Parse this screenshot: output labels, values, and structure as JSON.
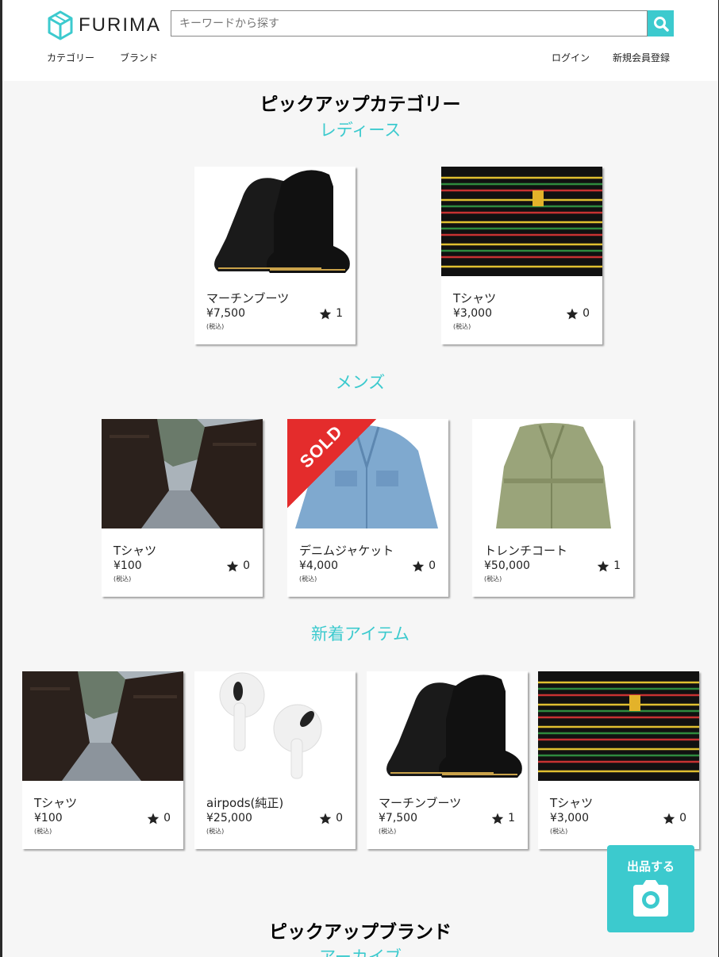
{
  "header": {
    "logo_text": "FURIMA",
    "search_placeholder": "キーワードから探す",
    "nav_category": "カテゴリー",
    "nav_brand": "ブランド",
    "nav_login": "ログイン",
    "nav_signup": "新規会員登録"
  },
  "colors": {
    "accent": "#3ccace",
    "sold": "#e42c2c",
    "background": "#f6f6f6"
  },
  "pickup_category_title": "ピックアップカテゴリー",
  "ladies": {
    "title": "レディース",
    "items": [
      {
        "name": "マーチンブーツ",
        "price": "¥7,500",
        "tax": "(税込)",
        "likes": "1",
        "image": "boots"
      },
      {
        "name": "Tシャツ",
        "price": "¥3,000",
        "tax": "(税込)",
        "likes": "0",
        "image": "striped-tshirt"
      }
    ]
  },
  "mens": {
    "title": "メンズ",
    "items": [
      {
        "name": "Tシャツ",
        "price": "¥100",
        "tax": "(税込)",
        "likes": "0",
        "image": "street"
      },
      {
        "name": "デニムジャケット",
        "price": "¥4,000",
        "tax": "(税込)",
        "likes": "0",
        "image": "denim-jacket",
        "sold_label": "SOLD"
      },
      {
        "name": "トレンチコート",
        "price": "¥50,000",
        "tax": "(税込)",
        "likes": "1",
        "image": "trench-coat"
      }
    ]
  },
  "new_items": {
    "title": "新着アイテム",
    "items": [
      {
        "name": "Tシャツ",
        "price": "¥100",
        "tax": "(税込)",
        "likes": "0",
        "image": "street"
      },
      {
        "name": "airpods(純正)",
        "price": "¥25,000",
        "tax": "(税込)",
        "likes": "0",
        "image": "airpods"
      },
      {
        "name": "マーチンブーツ",
        "price": "¥7,500",
        "tax": "(税込)",
        "likes": "1",
        "image": "boots"
      },
      {
        "name": "Tシャツ",
        "price": "¥3,000",
        "tax": "(税込)",
        "likes": "0",
        "image": "striped-tshirt"
      }
    ]
  },
  "pickup_brand_title": "ピックアップブランド",
  "brand_subtitle": "アーカイブ",
  "sell_button": {
    "label": "出品する",
    "icon": "camera-icon"
  }
}
